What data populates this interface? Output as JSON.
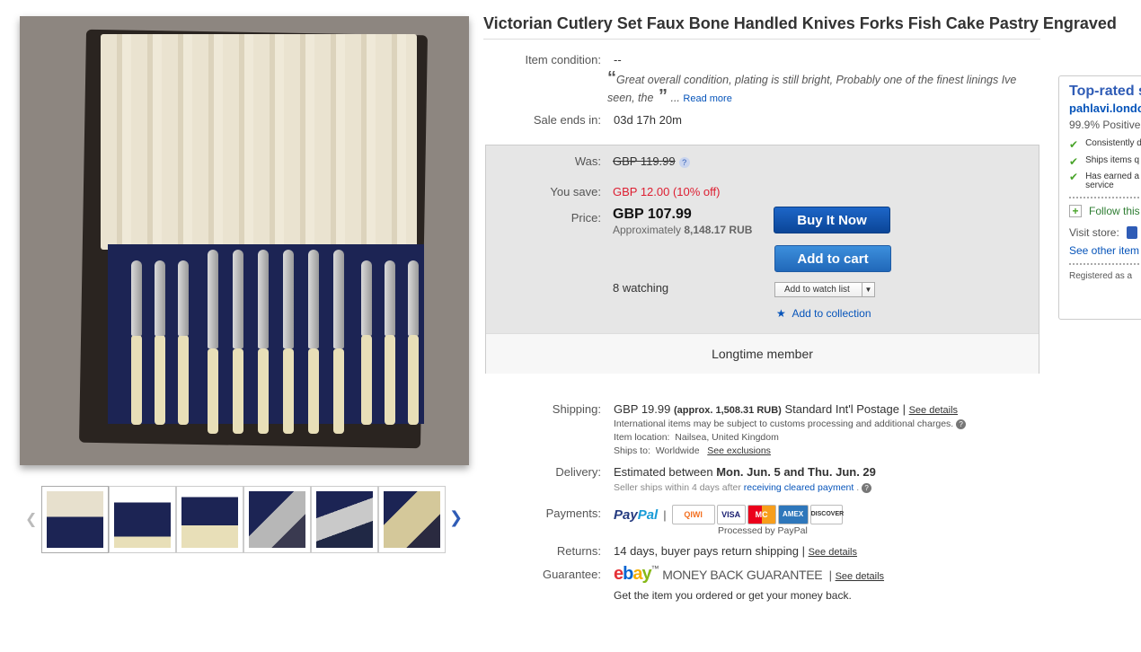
{
  "title": "Victorian Cutlery Set Faux Bone Handled Knives Forks Fish Cake Pastry Engraved",
  "condition": {
    "label": "Item condition:",
    "value": "--",
    "quote": "Great overall condition, plating is still bright, Probably one of the finest linings Ive seen, the",
    "ellipsis": "...",
    "read_more": "Read more"
  },
  "sale": {
    "label": "Sale ends in:",
    "value": "03d 17h 20m"
  },
  "price_box": {
    "was_label": "Was:",
    "was_value": "GBP 119.99",
    "save_label": "You save:",
    "save_value": "GBP 12.00 (10% off)",
    "price_label": "Price:",
    "price_value": "GBP 107.99",
    "approx_prefix": "Approximately",
    "approx_value": "8,148.17 RUB",
    "buy_now": "Buy It Now",
    "add_to_cart": "Add to cart",
    "watching": "8 watching",
    "watch_list": "Add to watch list",
    "add_collection": "Add to collection",
    "footer": "Longtime member"
  },
  "shipping": {
    "label": "Shipping:",
    "price": "GBP 19.99",
    "approx": "(approx. 1,508.31 RUB)",
    "method": "Standard Int'l Postage |",
    "details": "See details",
    "customs": "International items may be subject to customs processing and additional charges.",
    "location_label": "Item location:",
    "location": "Nailsea, United Kingdom",
    "ships_to_label": "Ships to:",
    "ships_to": "Worldwide",
    "exclusions": "See exclusions"
  },
  "delivery": {
    "label": "Delivery:",
    "prefix": "Estimated between",
    "dates": "Mon. Jun. 5 and Thu. Jun. 29",
    "note_prefix": "Seller ships within 4 days after",
    "note_link": "receiving cleared payment",
    "note_suffix": "."
  },
  "payments": {
    "label": "Payments:",
    "paypal_a": "Pay",
    "paypal_b": "Pal",
    "sep": "|",
    "cards": [
      "QIWI",
      "VISA",
      "MC",
      "AMEX",
      "DISCOVER"
    ],
    "processed": "Processed by PayPal"
  },
  "returns": {
    "label": "Returns:",
    "value": "14 days, buyer pays return shipping |",
    "details": "See details"
  },
  "guarantee": {
    "label": "Guarantee:",
    "logo": [
      "e",
      "b",
      "a",
      "y"
    ],
    "tm": "™",
    "text": "MONEY BACK GUARANTEE",
    "sep": "|",
    "details": "See details",
    "note": "Get the item you ordered or get your money back."
  },
  "seller": {
    "top_rated": "Top-rated s",
    "name": "pahlavi.londo",
    "positive": "99.9% Positive",
    "checks": [
      "Consistently d",
      "Ships items q",
      "Has earned a",
      "service"
    ],
    "follow": "Follow this",
    "visit": "Visit store:",
    "other": "See other item",
    "registered": "Registered as a"
  },
  "colors": {
    "link": "#0654ba",
    "red": "#dd1e31",
    "buy": "#0b4597",
    "cart": "#2168b9"
  }
}
